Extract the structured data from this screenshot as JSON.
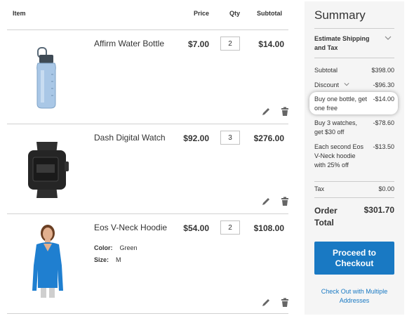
{
  "cart": {
    "headers": {
      "item": "Item",
      "price": "Price",
      "qty": "Qty",
      "subtotal": "Subtotal"
    },
    "items": [
      {
        "name": "Affirm Water Bottle",
        "price": "$7.00",
        "qty": "2",
        "subtotal": "$14.00"
      },
      {
        "name": "Dash Digital Watch",
        "price": "$92.00",
        "qty": "3",
        "subtotal": "$276.00"
      },
      {
        "name": "Eos V-Neck Hoodie",
        "price": "$54.00",
        "qty": "2",
        "subtotal": "$108.00",
        "options": [
          {
            "label": "Color:",
            "value": "Green"
          },
          {
            "label": "Size:",
            "value": "M"
          }
        ]
      }
    ]
  },
  "summary": {
    "title": "Summary",
    "estimate": "Estimate Shipping and Tax",
    "rows": [
      {
        "label": "Subtotal",
        "value": "$398.00"
      },
      {
        "label": "Discount",
        "value": "-$96.30"
      },
      {
        "label": "Buy one bottle, get one free",
        "value": "-$14.00"
      },
      {
        "label": "Buy 3 watches, get $30 off",
        "value": "-$78.60"
      },
      {
        "label": "Each second Eos V-Neck hoodie with 25% off",
        "value": "-$13.50"
      },
      {
        "label": "Tax",
        "value": "$0.00"
      }
    ],
    "order_total_label": "Order Total",
    "order_total_value": "$301.70",
    "checkout_label": "Proceed to Checkout",
    "multi_label": "Check Out with Multiple Addresses"
  },
  "colors": {
    "accent": "#1979c3",
    "summary_bg": "#f5f5f5",
    "divider": "#d1d1d1"
  },
  "icons": [
    "chevron-down-icon",
    "pencil-icon",
    "trash-icon"
  ]
}
